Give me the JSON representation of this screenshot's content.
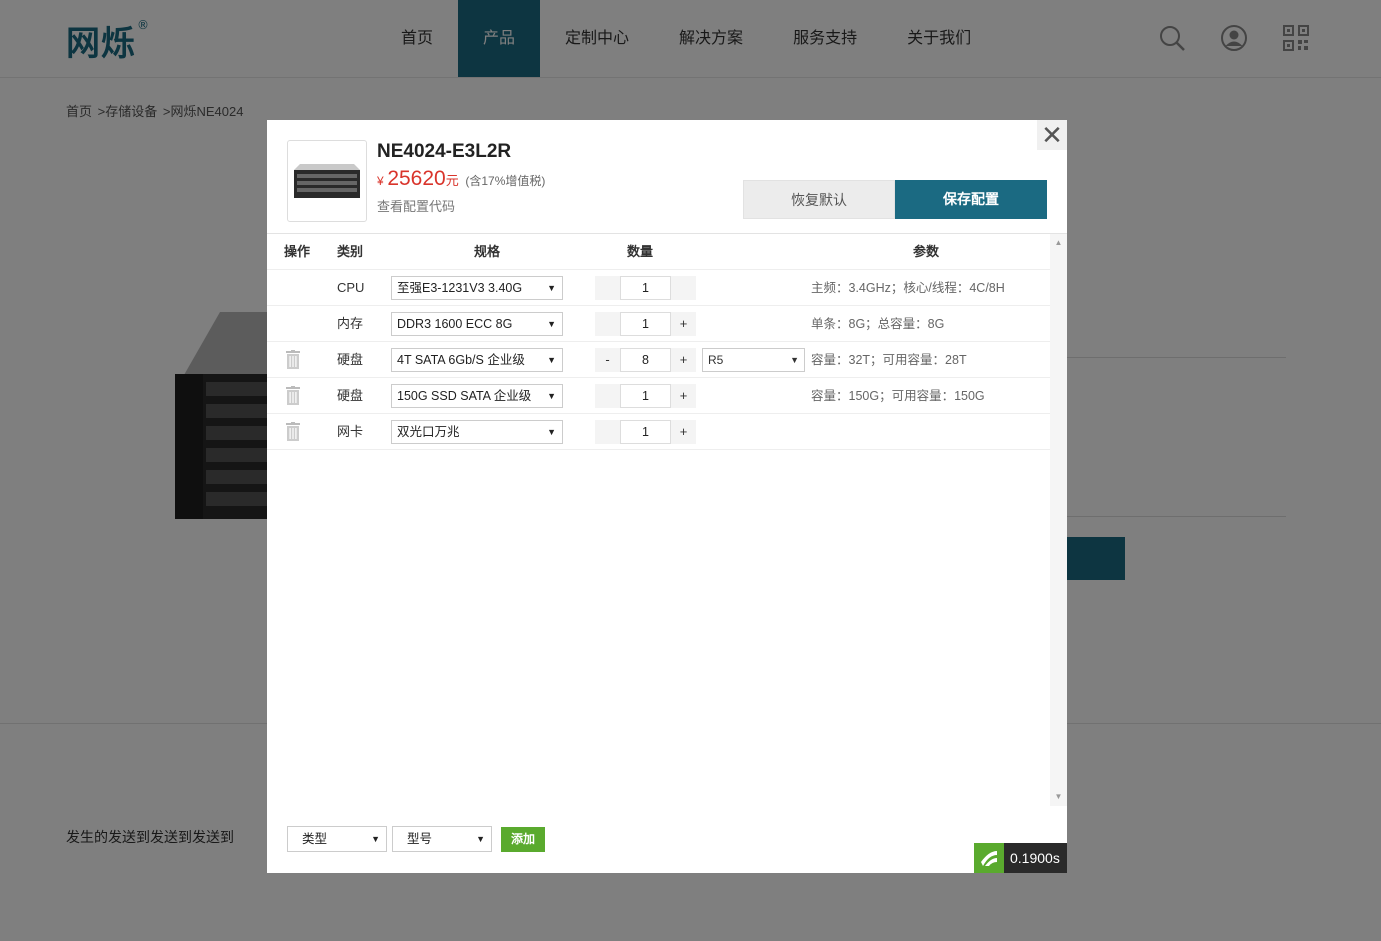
{
  "header": {
    "logo_text": "网烁",
    "logo_mark": "®",
    "nav": [
      "首页",
      "产品",
      "定制中心",
      "解决方案",
      "服务支持",
      "关于我们"
    ],
    "active_nav": "产品",
    "icons": [
      "search-icon",
      "user-icon",
      "qrcode-icon"
    ]
  },
  "breadcrumb": [
    "首页",
    ">存储设备",
    ">网烁NE4024"
  ],
  "page": {
    "description": "发生的发送到发送到发送到"
  },
  "modal": {
    "close_icon": "close-icon",
    "product_name": "NE4024-E3L2R",
    "price_symbol": "¥",
    "price": "25620",
    "price_unit": "元",
    "tax_note": "(含17%增值税)",
    "view_code": "查看配置代码",
    "reset_label": "恢复默认",
    "save_label": "保存配置",
    "accent_color": "#1b6a82",
    "price_color": "#d9342b",
    "table": {
      "headers": {
        "op": "操作",
        "category": "类别",
        "spec": "规格",
        "quantity": "数量",
        "params": "参数"
      },
      "rows": [
        {
          "deletable": false,
          "category": "CPU",
          "spec": "至强E3-1231V3 3.40G",
          "minus": "",
          "qty": "1",
          "plus": "",
          "raid": "",
          "params": "主频：3.4GHz；核心/线程：4C/8H"
        },
        {
          "deletable": false,
          "category": "内存",
          "spec": "DDR3 1600 ECC 8G",
          "minus": "",
          "qty": "1",
          "plus": "+",
          "raid": "",
          "params": "单条：8G；总容量：8G"
        },
        {
          "deletable": true,
          "category": "硬盘",
          "spec": "4T SATA 6Gb/S 企业级",
          "minus": "-",
          "qty": "8",
          "plus": "+",
          "raid": "R5",
          "params": "容量：32T；可用容量：28T"
        },
        {
          "deletable": true,
          "category": "硬盘",
          "spec": "150G SSD SATA 企业级",
          "minus": "",
          "qty": "1",
          "plus": "+",
          "raid": "",
          "params": "容量：150G；可用容量：150G"
        },
        {
          "deletable": true,
          "category": "网卡",
          "spec": "双光口万兆",
          "minus": "",
          "qty": "1",
          "plus": "+",
          "raid": "",
          "params": ""
        }
      ]
    },
    "add_bar": {
      "type_placeholder": "类型",
      "model_placeholder": "型号",
      "add_label": "添加"
    },
    "timer": "0.1900s"
  }
}
